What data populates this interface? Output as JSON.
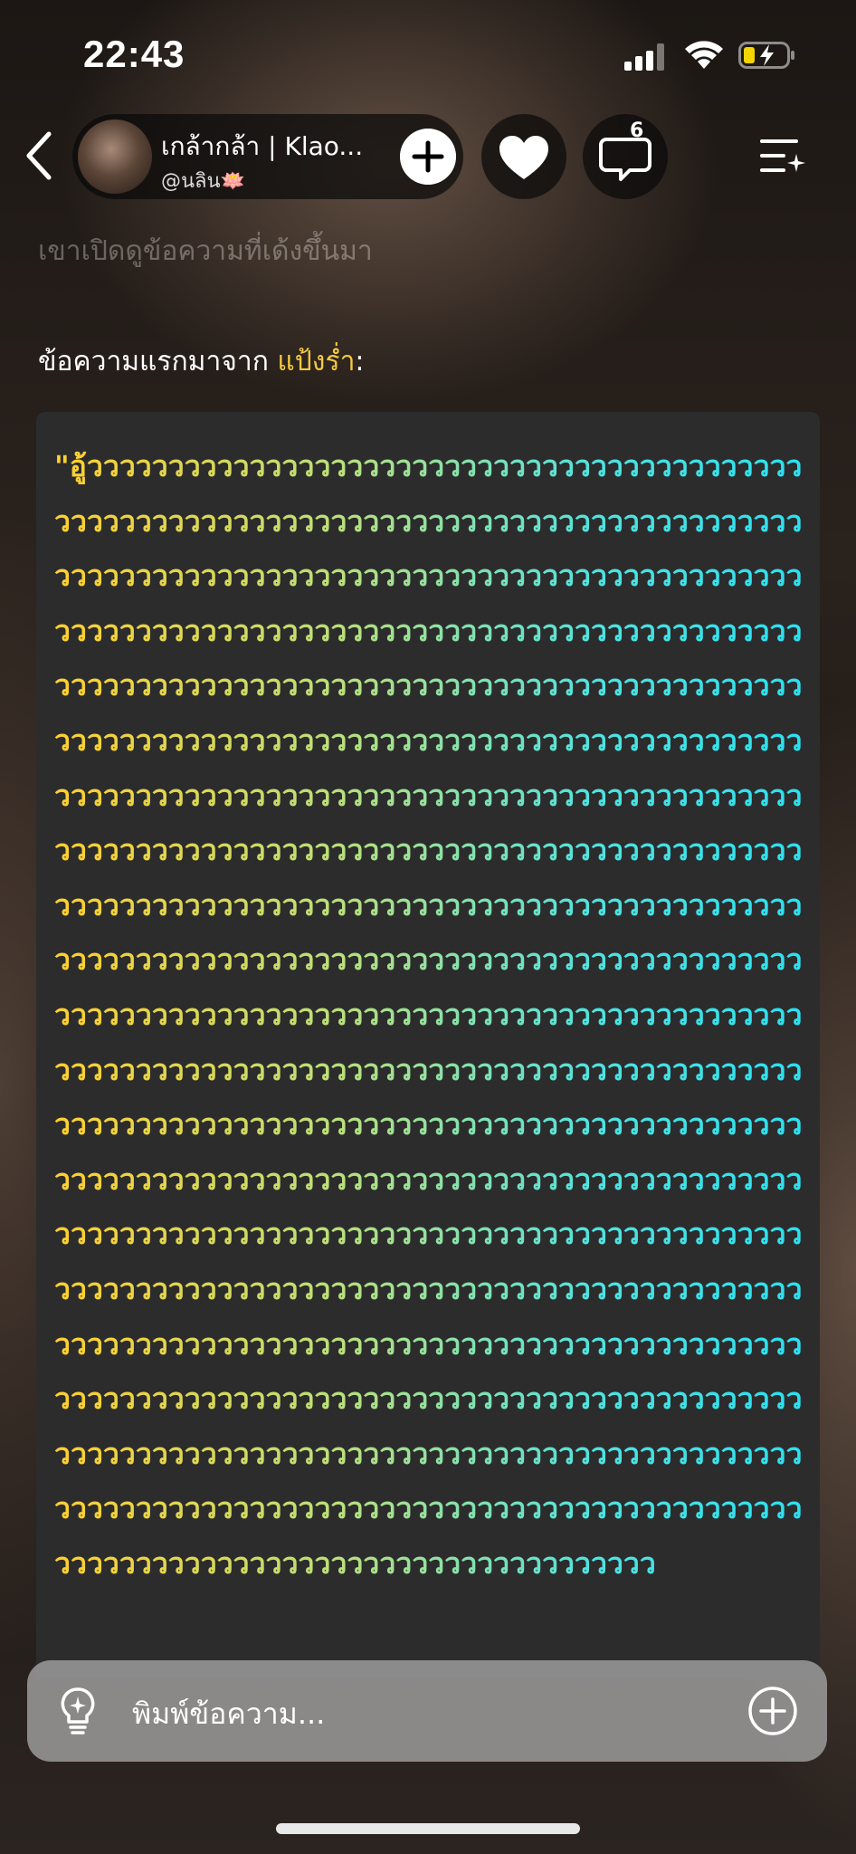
{
  "status_bar": {
    "time": "22:43"
  },
  "header": {
    "profile_name": "เกล้ากล้า | Klao...",
    "profile_handle": "@นลิน🪷",
    "comment_count": "6"
  },
  "chat": {
    "previous_text": "เขาเปิดดูข้อความที่เด้งขึ้นมา",
    "first_message_prefix": "ข้อความแรกมาจาก ",
    "first_message_sender": "แป้งร่ำ",
    "first_message_suffix": ":",
    "message_body": "\"อู้ววววววววววววววววววววววววววววววววววววววววววววววววววววววววววววววววววววววววววววววววววววววววววววววววววววววววววววววววววววววววววววววววววววววววววววววววววววววววววววววววววววววววววววววววววววววววววววววววววววววววววววววววววววววววววววววววววววววววววววววววววววววววววววววววววววววววววววววววววววววววววววววววววววววววววววววววววววววววววววววววววววววววววววววววววววววววววววววววววววววววววววววววววววววววววววววววววววววววววววววววววววววววววววววววววววววววววววววววววววววววววววววววววววววววววววววววววววววววววววววววววววววววววววววววววววววววววววววววววววววววววววววววววววววววววววววววววววววววววววววววววววววววววววววววววววววววววววววววววววววววววววววววววววววววววววววววววววววววววววววววววววววววววววววววววววววววววววววววววววววววววววววววววววววววววววววววววววววววววววววววววววววววววววววววววววววววววววววววววววววววววววววววววววววววววววววววววววววววววววววววววววววววววววววววววววววววววววววววววววววววววววววววววววววววววววววววววววววววววววววววววววววววววววววววววววววววววววววววววววววววววววววววววววววววววววววววววววววววววว"
  },
  "input": {
    "placeholder": "พิมพ์ข้อความ..."
  },
  "colors": {
    "accent_name": "#f5c842",
    "gradient_start": "#ffcf2e",
    "gradient_end": "#29e1f2"
  }
}
